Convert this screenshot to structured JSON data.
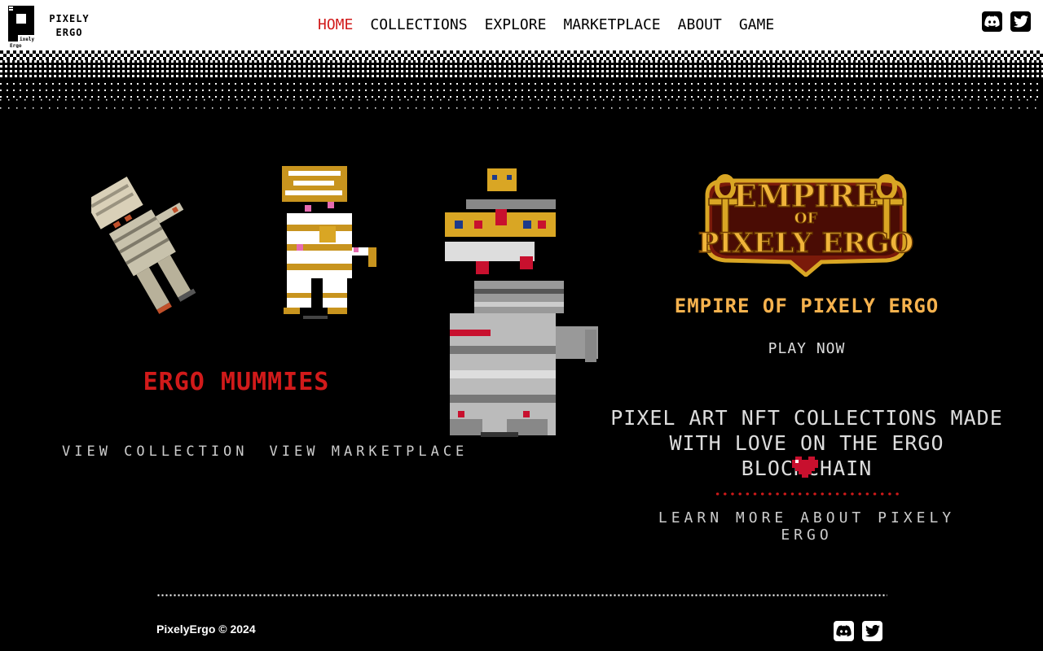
{
  "brand": {
    "line1": "PIXELY",
    "line2": "ERGO"
  },
  "nav": [
    {
      "label": "HOME",
      "active": true
    },
    {
      "label": "COLLECTIONS",
      "active": false
    },
    {
      "label": "EXPLORE",
      "active": false
    },
    {
      "label": "MARKETPLACE",
      "active": false
    },
    {
      "label": "ABOUT",
      "active": false
    },
    {
      "label": "GAME",
      "active": false
    }
  ],
  "collection": {
    "title": "ERGO MUMMIES",
    "view_collection": "VIEW COLLECTION",
    "view_marketplace": "VIEW MARKETPLACE"
  },
  "game": {
    "logo_line1": "EMPIRE",
    "logo_line2": "OF",
    "logo_line3": "PIXELY ERGO",
    "title": "EMPIRE OF PIXELY ERGO",
    "play": "PLAY NOW"
  },
  "tagline": {
    "line1": "PIXEL ART NFT COLLECTIONS MADE",
    "line2": "WITH LOVE ON THE ERGO BLOCKCHAIN"
  },
  "learn_more": "LEARN MORE ABOUT PIXELY ERGO",
  "footer": {
    "copyright": "PixelyErgo © 2024"
  },
  "colors": {
    "accent_red": "#d11a1a",
    "game_gold": "#f6b24e",
    "bg": "#000000"
  },
  "icons": [
    "discord-icon",
    "twitter-icon",
    "heart-icon"
  ]
}
